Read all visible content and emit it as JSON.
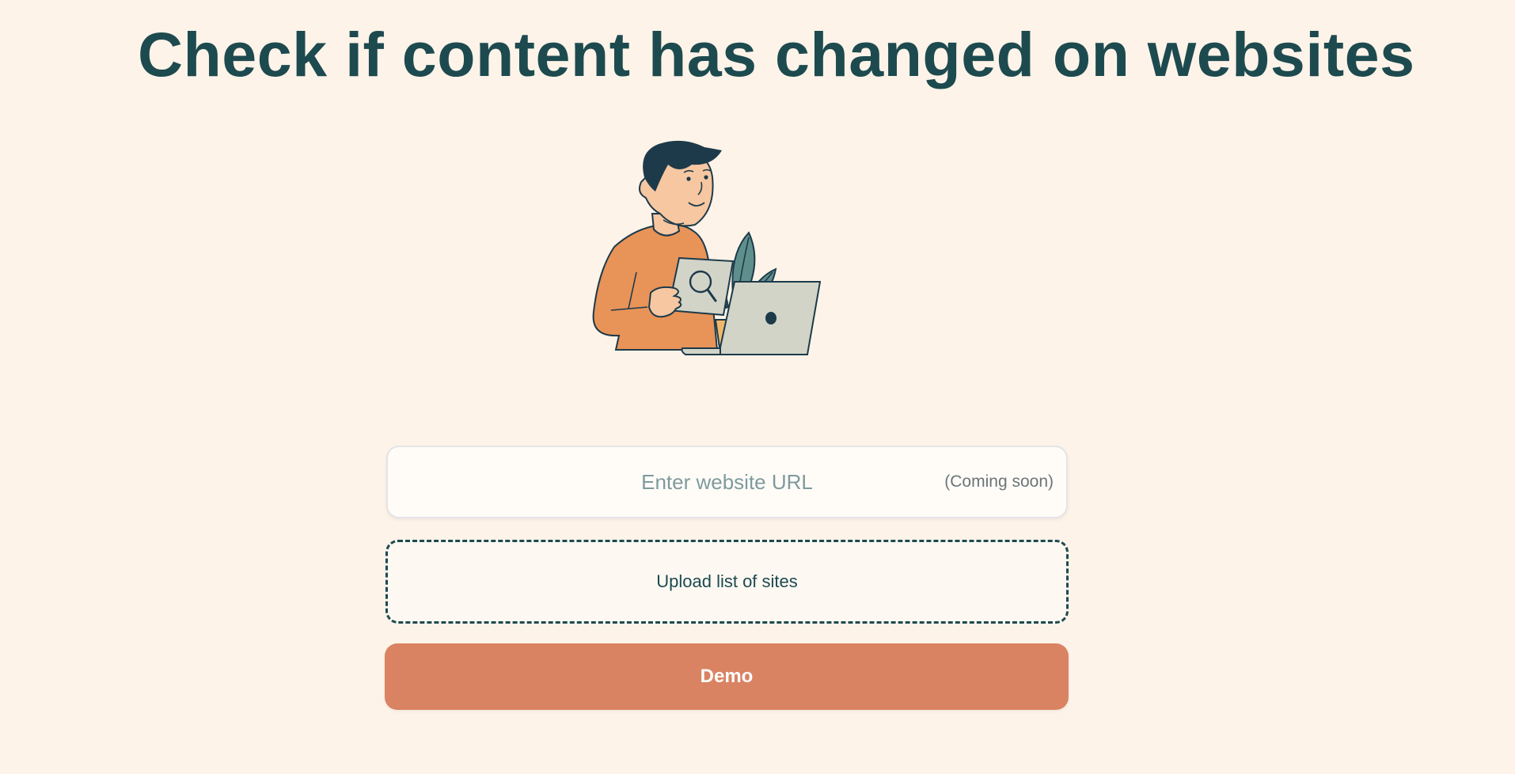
{
  "header": {
    "title": "Check if content has changed on websites"
  },
  "illustration": {
    "icon": "person-with-laptop-and-plant-illustration"
  },
  "url_input": {
    "placeholder": "Enter website URL",
    "value": "",
    "note": "(Coming soon)"
  },
  "upload": {
    "label": "Upload list of sites"
  },
  "demo_button": {
    "label": "Demo"
  },
  "colors": {
    "background": "#fdf3e8",
    "title": "#1d4a4f",
    "accent_button": "#d98363",
    "dashed_border": "#1d4a4f"
  }
}
